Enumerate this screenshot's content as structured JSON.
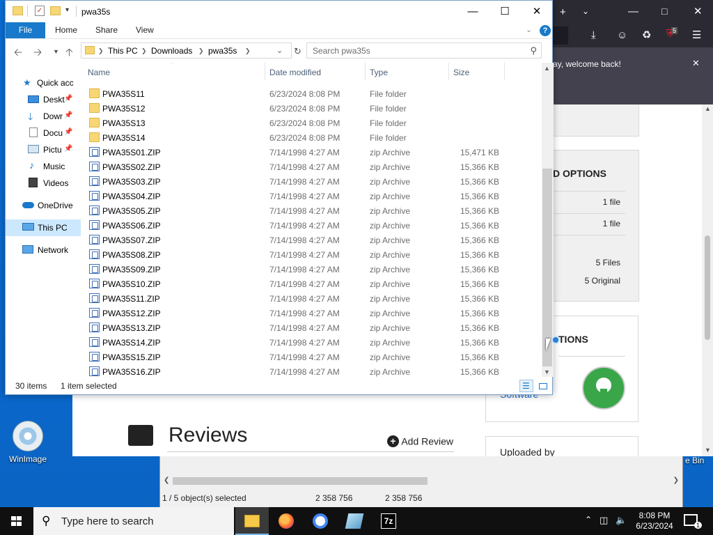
{
  "desktop": {
    "icon_label": "WinImage",
    "recycle_bin_partial": "e Bin"
  },
  "browser": {
    "notification_text": "ay, welcome back!",
    "extension_badge": "5",
    "card1_title": "D OPTIONS",
    "card1_rows": [
      "1 file",
      "1 file",
      "5 Files",
      "5 Original"
    ],
    "card2_title": "TIONS",
    "card2_link": "Software",
    "reviews_title": "Reviews",
    "add_review": "Add Review",
    "uploaded_by": "Uploaded by"
  },
  "sevenzip": {
    "status_selected": "1 / 5 object(s) selected",
    "size1": "2 358 756",
    "size2": "2 358 756"
  },
  "explorer": {
    "title": "pwa35s",
    "ribbon_tabs": [
      "File",
      "Home",
      "Share",
      "View"
    ],
    "breadcrumb": [
      "This PC",
      "Downloads",
      "pwa35s"
    ],
    "search_placeholder": "Search pwa35s",
    "nav_items": [
      {
        "label": "Quick acc",
        "icon": "star-icon"
      },
      {
        "label": "Deskt",
        "icon": "desktop-icon"
      },
      {
        "label": "Dowr",
        "icon": "download-icon"
      },
      {
        "label": "Docu",
        "icon": "documents-icon"
      },
      {
        "label": "Pictu",
        "icon": "pictures-icon"
      },
      {
        "label": "Music",
        "icon": "music-icon"
      },
      {
        "label": "Videos",
        "icon": "videos-icon"
      },
      {
        "label": "OneDrive",
        "icon": "cloud-icon"
      },
      {
        "label": "This PC",
        "icon": "computer-icon"
      },
      {
        "label": "Network",
        "icon": "network-icon"
      }
    ],
    "columns": [
      "Name",
      "Date modified",
      "Type",
      "Size"
    ],
    "rows": [
      {
        "name": "PWA35S11",
        "date": "6/23/2024 8:08 PM",
        "type": "File folder",
        "size": "",
        "kind": "folder"
      },
      {
        "name": "PWA35S12",
        "date": "6/23/2024 8:08 PM",
        "type": "File folder",
        "size": "",
        "kind": "folder"
      },
      {
        "name": "PWA35S13",
        "date": "6/23/2024 8:08 PM",
        "type": "File folder",
        "size": "",
        "kind": "folder"
      },
      {
        "name": "PWA35S14",
        "date": "6/23/2024 8:08 PM",
        "type": "File folder",
        "size": "",
        "kind": "folder"
      },
      {
        "name": "PWA35S01.ZIP",
        "date": "7/14/1998 4:27 AM",
        "type": "zip Archive",
        "size": "15,471 KB",
        "kind": "zip"
      },
      {
        "name": "PWA35S02.ZIP",
        "date": "7/14/1998 4:27 AM",
        "type": "zip Archive",
        "size": "15,366 KB",
        "kind": "zip"
      },
      {
        "name": "PWA35S03.ZIP",
        "date": "7/14/1998 4:27 AM",
        "type": "zip Archive",
        "size": "15,366 KB",
        "kind": "zip"
      },
      {
        "name": "PWA35S04.ZIP",
        "date": "7/14/1998 4:27 AM",
        "type": "zip Archive",
        "size": "15,366 KB",
        "kind": "zip"
      },
      {
        "name": "PWA35S05.ZIP",
        "date": "7/14/1998 4:27 AM",
        "type": "zip Archive",
        "size": "15,366 KB",
        "kind": "zip"
      },
      {
        "name": "PWA35S06.ZIP",
        "date": "7/14/1998 4:27 AM",
        "type": "zip Archive",
        "size": "15,366 KB",
        "kind": "zip"
      },
      {
        "name": "PWA35S07.ZIP",
        "date": "7/14/1998 4:27 AM",
        "type": "zip Archive",
        "size": "15,366 KB",
        "kind": "zip"
      },
      {
        "name": "PWA35S08.ZIP",
        "date": "7/14/1998 4:27 AM",
        "type": "zip Archive",
        "size": "15,366 KB",
        "kind": "zip"
      },
      {
        "name": "PWA35S09.ZIP",
        "date": "7/14/1998 4:27 AM",
        "type": "zip Archive",
        "size": "15,366 KB",
        "kind": "zip"
      },
      {
        "name": "PWA35S10.ZIP",
        "date": "7/14/1998 4:27 AM",
        "type": "zip Archive",
        "size": "15,366 KB",
        "kind": "zip"
      },
      {
        "name": "PWA35S11.ZIP",
        "date": "7/14/1998 4:27 AM",
        "type": "zip Archive",
        "size": "15,366 KB",
        "kind": "zip"
      },
      {
        "name": "PWA35S12.ZIP",
        "date": "7/14/1998 4:27 AM",
        "type": "zip Archive",
        "size": "15,366 KB",
        "kind": "zip"
      },
      {
        "name": "PWA35S13.ZIP",
        "date": "7/14/1998 4:27 AM",
        "type": "zip Archive",
        "size": "15,366 KB",
        "kind": "zip"
      },
      {
        "name": "PWA35S14.ZIP",
        "date": "7/14/1998 4:27 AM",
        "type": "zip Archive",
        "size": "15,366 KB",
        "kind": "zip"
      },
      {
        "name": "PWA35S15.ZIP",
        "date": "7/14/1998 4:27 AM",
        "type": "zip Archive",
        "size": "15,366 KB",
        "kind": "zip"
      },
      {
        "name": "PWA35S16.ZIP",
        "date": "7/14/1998 4:27 AM",
        "type": "zip Archive",
        "size": "15,366 KB",
        "kind": "zip"
      }
    ],
    "status_items": "30 items",
    "status_selected": "1 item selected"
  },
  "taskbar": {
    "search_placeholder": "Type here to search",
    "time": "8:08 PM",
    "date": "6/23/2024",
    "notification_badge": "1"
  },
  "colors": {
    "accent": "#1979ca",
    "desktop": "#0a6fd6",
    "taskbar": "#101010",
    "browser_chrome": "#2b2a33"
  }
}
